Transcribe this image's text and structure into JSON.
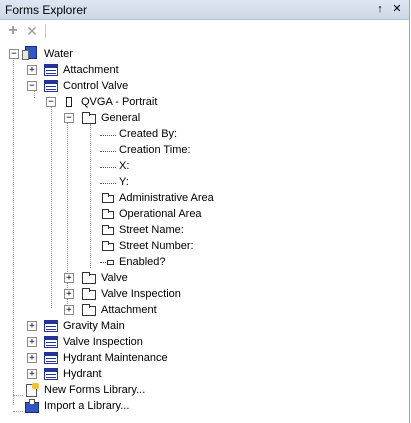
{
  "panel": {
    "title": "Forms Explorer",
    "pin_glyph": "↑",
    "close_glyph": "✕"
  },
  "toolbar": {
    "add_glyph": "+",
    "delete_glyph": "✕"
  },
  "tree": {
    "root": "Water",
    "items": {
      "attachment": "Attachment",
      "control_valve": "Control Valve",
      "qvga": "QVGA - Portrait",
      "general": "General",
      "created_by": "Created By:",
      "creation_time": "Creation Time:",
      "x": "X:",
      "y": "Y:",
      "admin_area": "Administrative Area",
      "operational_area": "Operational Area",
      "street_name": "Street Name:",
      "street_number": "Street Number:",
      "enabled": "Enabled?",
      "valve": "Valve",
      "valve_inspection_folder": "Valve Inspection",
      "attachment_folder": "Attachment",
      "gravity_main": "Gravity Main",
      "valve_inspection": "Valve Inspection",
      "hydrant_maintenance": "Hydrant Maintenance",
      "hydrant": "Hydrant"
    },
    "new_library": "New Forms Library...",
    "import_library": "Import a Library...",
    "expand_glyph": "+",
    "collapse_glyph": "−"
  }
}
